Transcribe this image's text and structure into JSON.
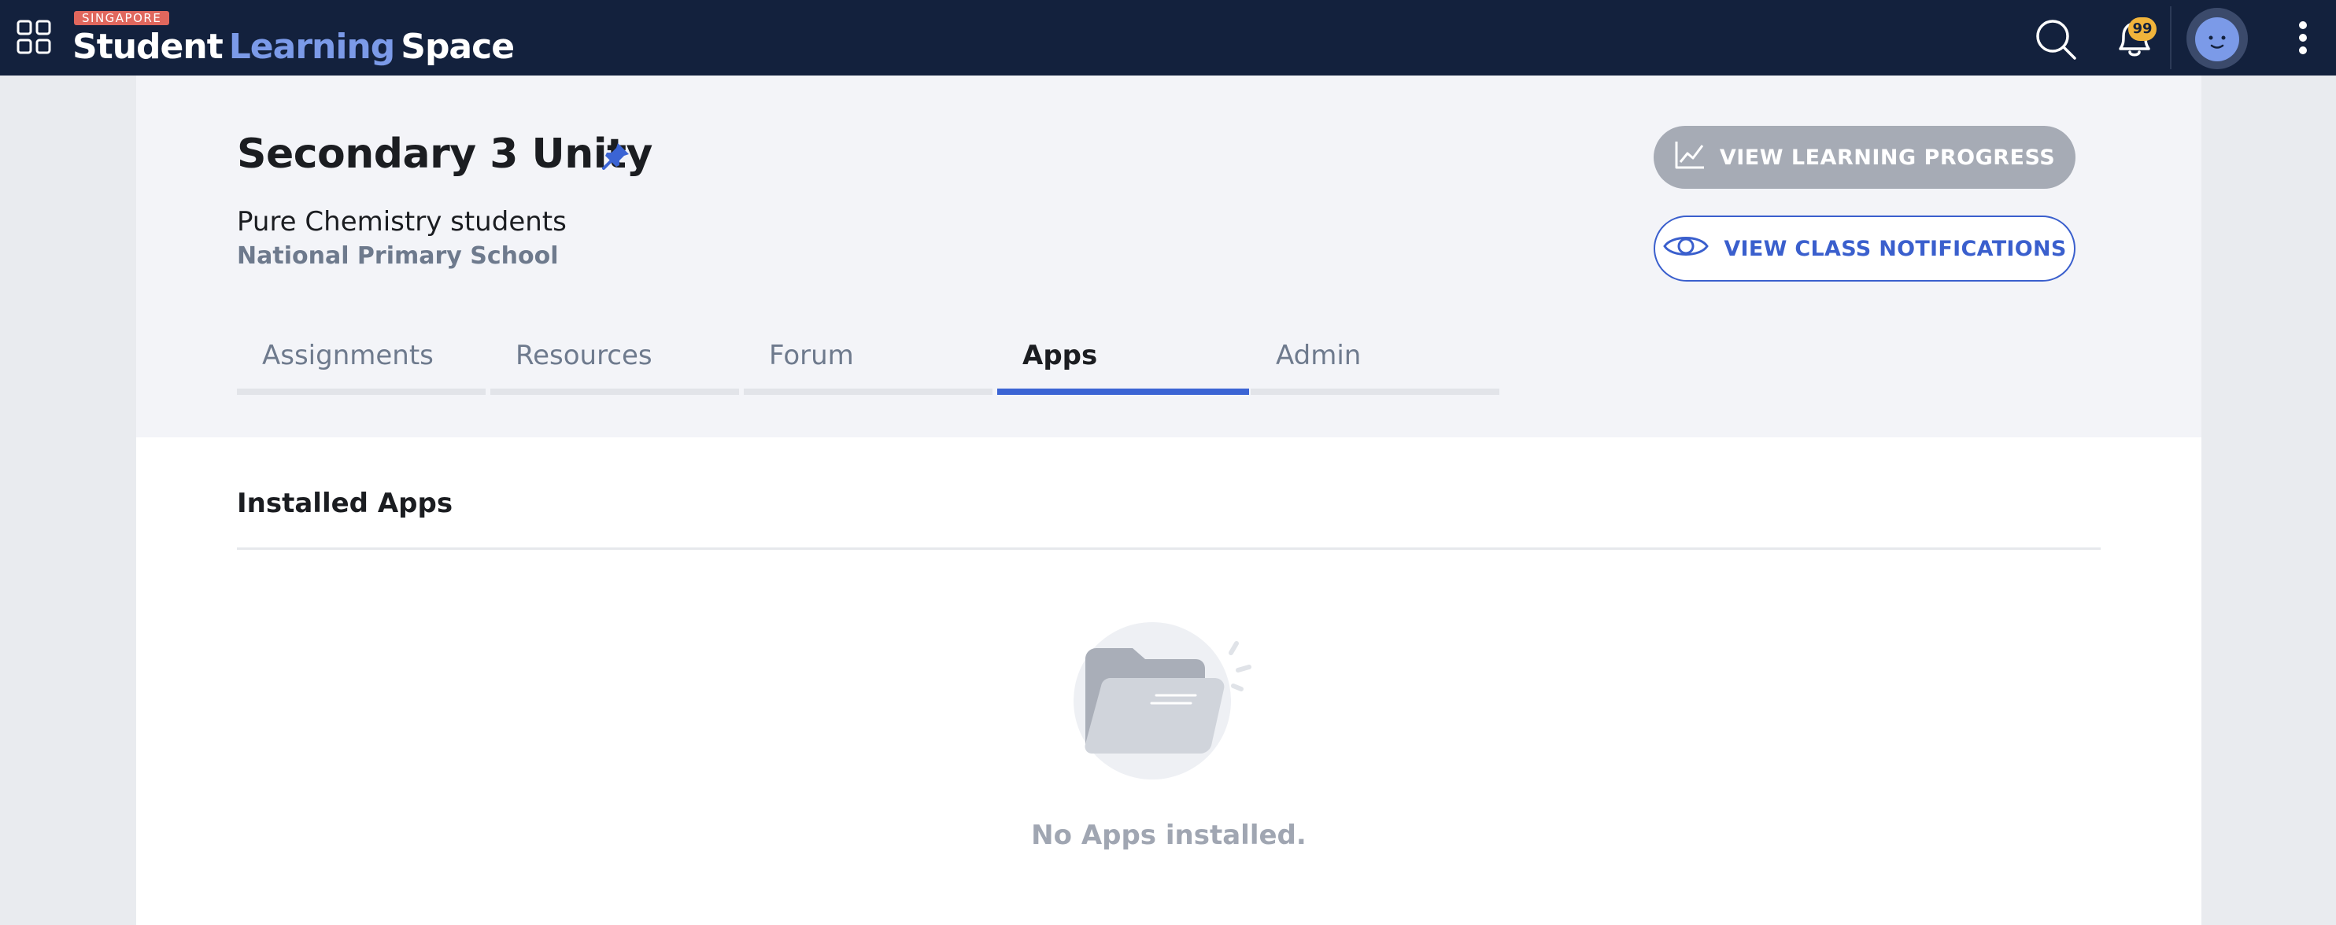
{
  "header": {
    "brand": {
      "flag": "SINGAPORE",
      "word1": "Student",
      "word2": "Learning",
      "word3": "Space"
    },
    "notification_count": "99",
    "icons": [
      "apps-grid-icon",
      "search-icon",
      "bell-icon",
      "avatar",
      "more-vertical-icon"
    ]
  },
  "class": {
    "title": "Secondary 3 Unity",
    "description": "Pure Chemistry students",
    "school": "National Primary School"
  },
  "actions": {
    "progress_label": "VIEW LEARNING PROGRESS",
    "notifications_label": "VIEW CLASS NOTIFICATIONS"
  },
  "tabs": [
    {
      "label": "Assignments",
      "active": false
    },
    {
      "label": "Resources",
      "active": false
    },
    {
      "label": "Forum",
      "active": false
    },
    {
      "label": "Apps",
      "active": true
    },
    {
      "label": "Admin",
      "active": false
    }
  ],
  "apps": {
    "section_title": "Installed Apps",
    "empty_message": "No Apps installed."
  },
  "colors": {
    "topbar": "#13213d",
    "accent": "#3b64d4",
    "brand_learning": "#7b9ae8",
    "badge": "#f1b43b",
    "disabled_button": "#a6abb5"
  }
}
